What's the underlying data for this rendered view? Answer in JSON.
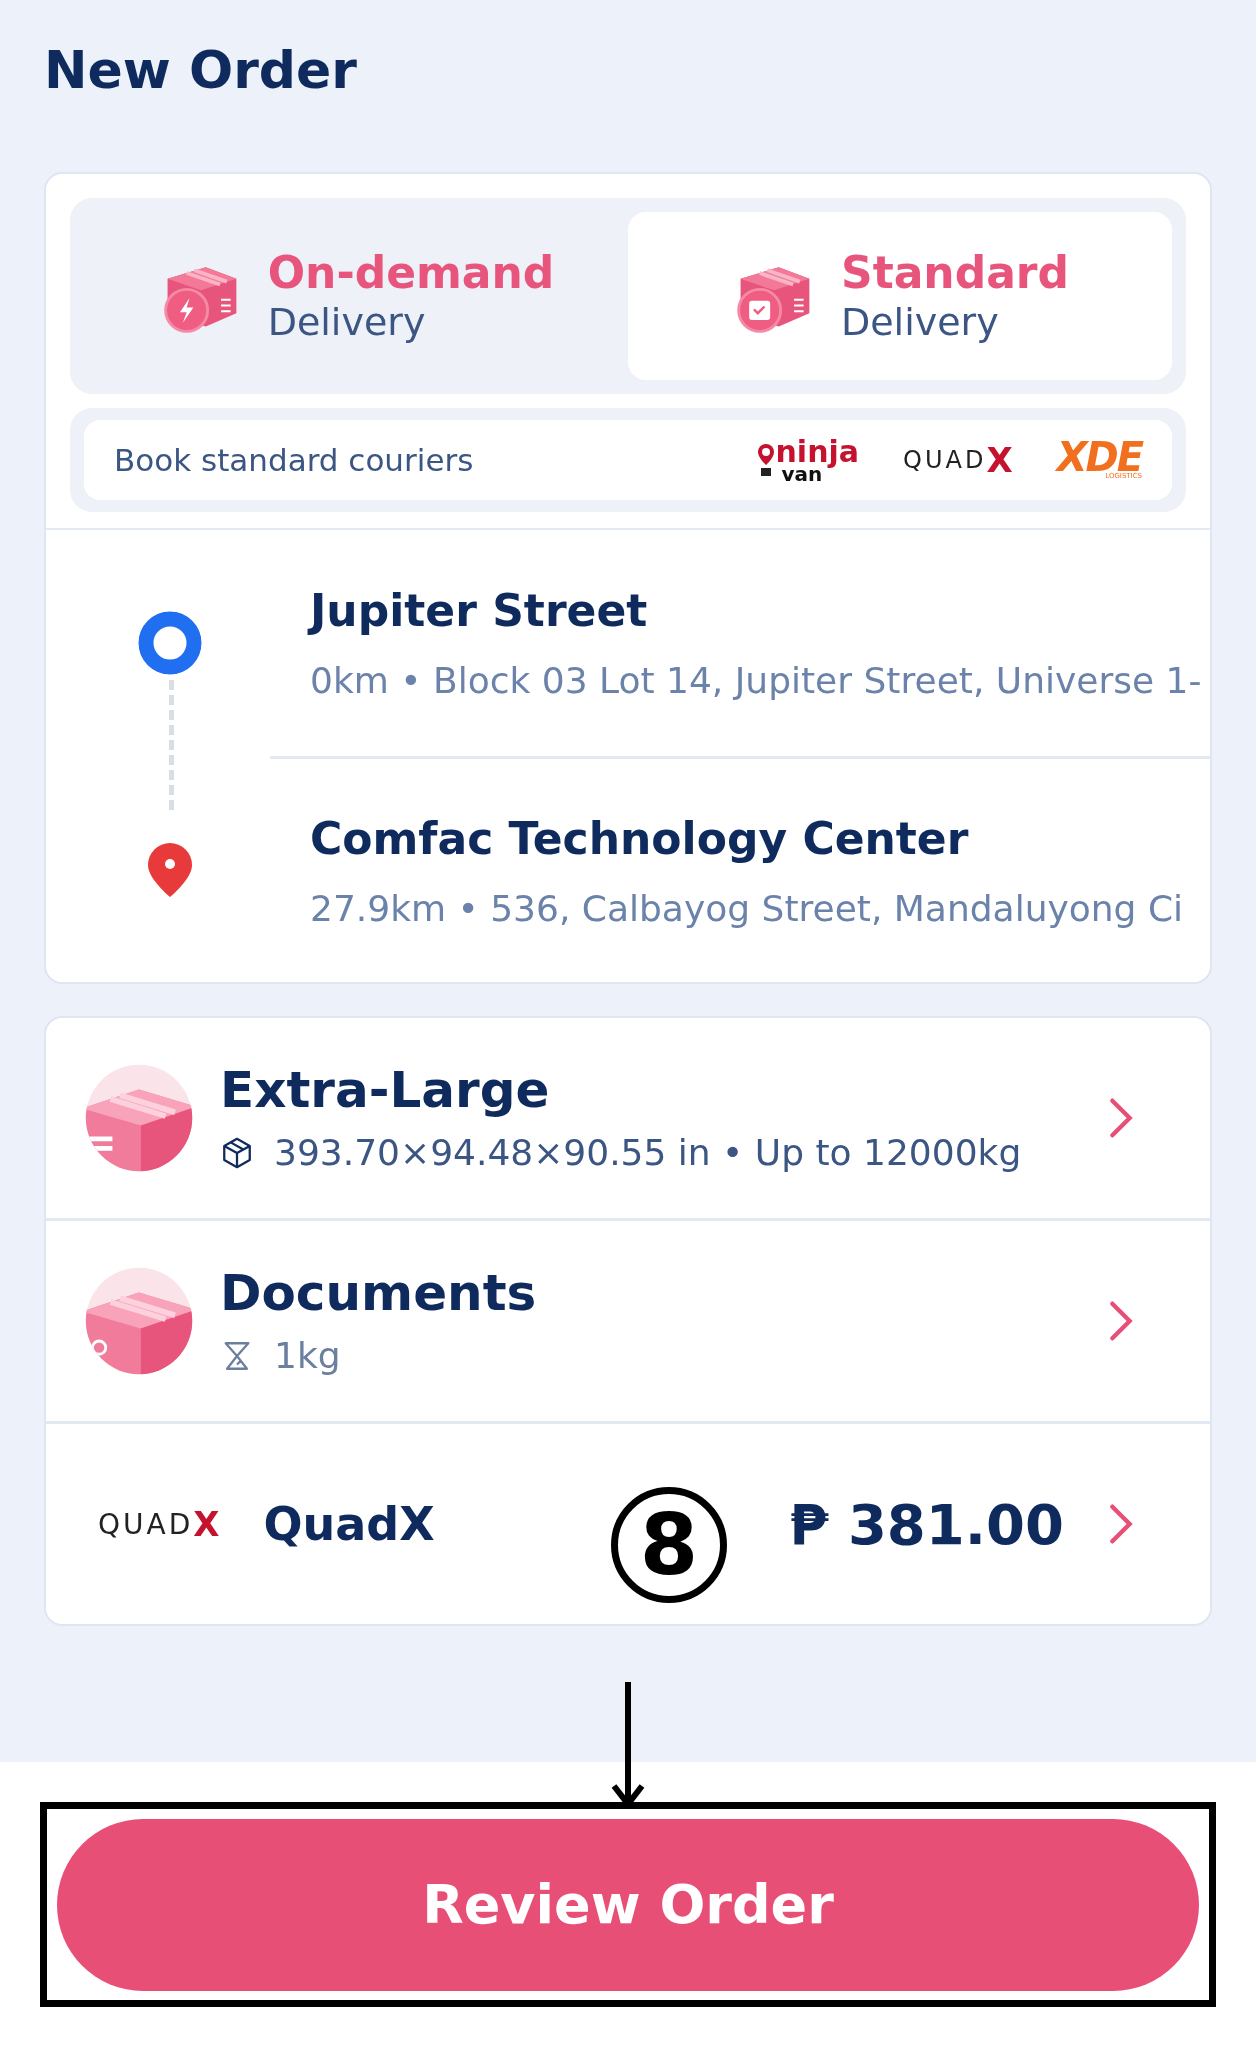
{
  "title": "New Order",
  "delivery_tabs": [
    {
      "kind": "on-demand",
      "label": "On-demand",
      "sublabel": "Delivery",
      "selected": false
    },
    {
      "kind": "standard",
      "label": "Standard",
      "sublabel": "Delivery",
      "selected": true
    }
  ],
  "couriers_banner": {
    "text": "Book standard couriers",
    "logos": [
      {
        "kind": "ninjavan",
        "text": "ninja",
        "subtext": "van"
      },
      {
        "kind": "quadx",
        "text": "QUAD",
        "mark": "X"
      },
      {
        "kind": "xde",
        "text": "XDE",
        "subtext": "LOGISTICS"
      }
    ]
  },
  "route": [
    {
      "kind": "pickup",
      "name": "Jupiter Street",
      "detail": "0km • Block 03 Lot 14, Jupiter Street, Universe 1-"
    },
    {
      "kind": "dropoff",
      "name": "Comfac Technology Center",
      "detail": "27.9km • 536, Calbayog Street, Mandaluyong Ci"
    }
  ],
  "items": [
    {
      "kind": "size",
      "name": "Extra-Large",
      "detail": "393.70×94.48×90.55 in • Up to 12000kg"
    },
    {
      "kind": "weight",
      "name": "Documents",
      "detail": "1kg"
    }
  ],
  "courier": {
    "logo_text": "QUAD",
    "logo_mark": "X",
    "name": "QuadX",
    "price": "₱ 381.00"
  },
  "annotation": {
    "label": "8"
  },
  "review_button": {
    "label": "Review Order"
  }
}
